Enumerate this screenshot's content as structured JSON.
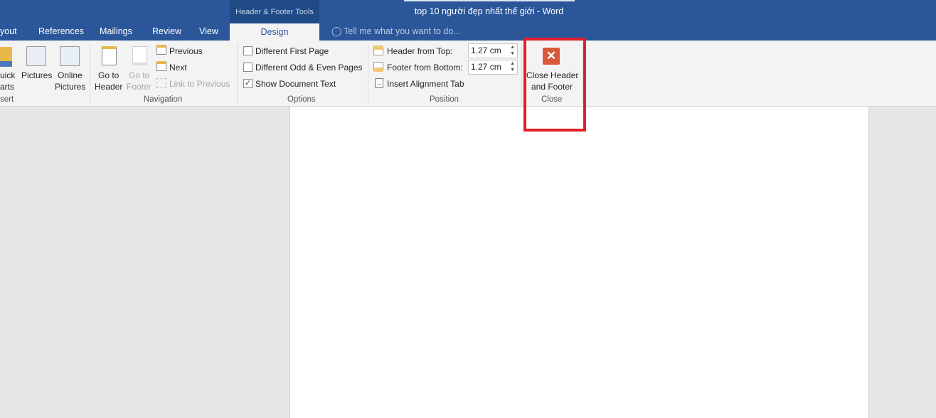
{
  "window": {
    "title": "top 10 người đẹp nhất thế giới - Word",
    "contextual_tab": "Header & Footer Tools"
  },
  "tabs": [
    "yout",
    "References",
    "Mailings",
    "Review",
    "View",
    "Design"
  ],
  "tell_me": "Tell me what you want to do...",
  "insert_group": {
    "label": "sert",
    "quick_parts": [
      "uick",
      "arts"
    ],
    "pictures": "Pictures",
    "online_pictures": [
      "Online",
      "Pictures"
    ]
  },
  "navigation": {
    "label": "Navigation",
    "go_to_header": [
      "Go to",
      "Header"
    ],
    "go_to_footer": [
      "Go to",
      "Footer"
    ],
    "previous": "Previous",
    "next": "Next",
    "link_to_previous": "Link to Previous"
  },
  "options": {
    "label": "Options",
    "items": [
      {
        "label": "Different First Page",
        "checked": false
      },
      {
        "label": "Different Odd & Even Pages",
        "checked": false
      },
      {
        "label": "Show Document Text",
        "checked": true
      }
    ]
  },
  "position": {
    "label": "Position",
    "header_from_top": "Header from Top:",
    "header_value": "1.27 cm",
    "footer_from_bottom": "Footer from Bottom:",
    "footer_value": "1.27 cm",
    "insert_alignment_tab": "Insert Alignment Tab"
  },
  "close": {
    "label": "Close",
    "button": [
      "Close Header",
      "and Footer"
    ]
  },
  "colors": {
    "title_bar": "#2b579a",
    "close_icon": "#d9573b",
    "highlight_box": "#e41e26"
  }
}
